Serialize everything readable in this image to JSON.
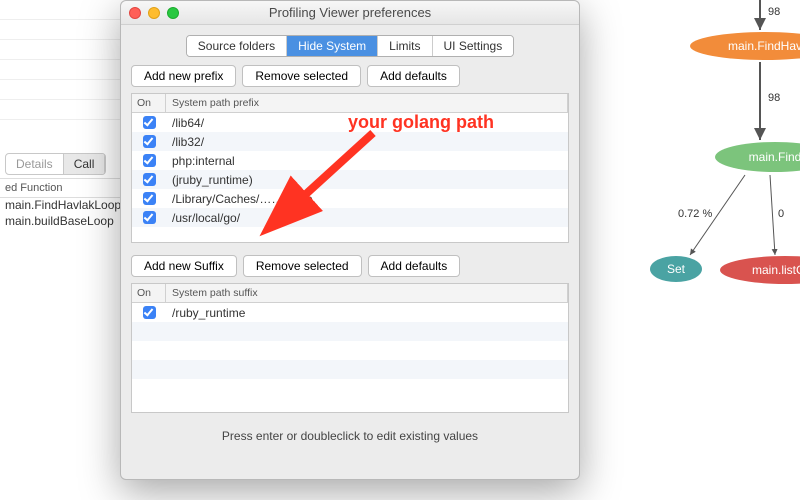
{
  "window": {
    "title": "Profiling Viewer preferences"
  },
  "tabs": [
    "Source folders",
    "Hide System",
    "Limits",
    "UI Settings"
  ],
  "tabs_active_index": 1,
  "prefix_section": {
    "buttons": {
      "add": "Add new prefix",
      "remove": "Remove selected",
      "defaults": "Add defaults"
    },
    "columns": {
      "on": "On",
      "path": "System path prefix"
    },
    "rows": [
      {
        "on": true,
        "path": "/lib64/"
      },
      {
        "on": true,
        "path": "/lib32/"
      },
      {
        "on": true,
        "path": "php:internal"
      },
      {
        "on": true,
        "path": "(jruby_runtime)"
      },
      {
        "on": true,
        "path": "/Library/Caches/……apple."
      },
      {
        "on": true,
        "path": "/usr/local/go/"
      }
    ]
  },
  "suffix_section": {
    "buttons": {
      "add": "Add new Suffix",
      "remove": "Remove selected",
      "defaults": "Add defaults"
    },
    "columns": {
      "on": "On",
      "path": "System path suffix"
    },
    "rows": [
      {
        "on": true,
        "path": "/ruby_runtime"
      }
    ]
  },
  "footer": "Press enter or doubleclick to edit existing values",
  "annotation": {
    "text": "your golang path"
  },
  "background": {
    "tabs": {
      "t1": "Details",
      "t2": "Call"
    },
    "header": "ed Function",
    "rows": [
      "main.FindHavlakLoops",
      "main.buildBaseLoop"
    ]
  },
  "graph": {
    "edge_labels": {
      "e1": "98",
      "e2": "98",
      "e3": "0.72 %",
      "e4": "0"
    },
    "nodes": {
      "n1": "main.FindHav",
      "n2": "main.Find",
      "n3": "Set",
      "n4": "main.listCon"
    }
  }
}
